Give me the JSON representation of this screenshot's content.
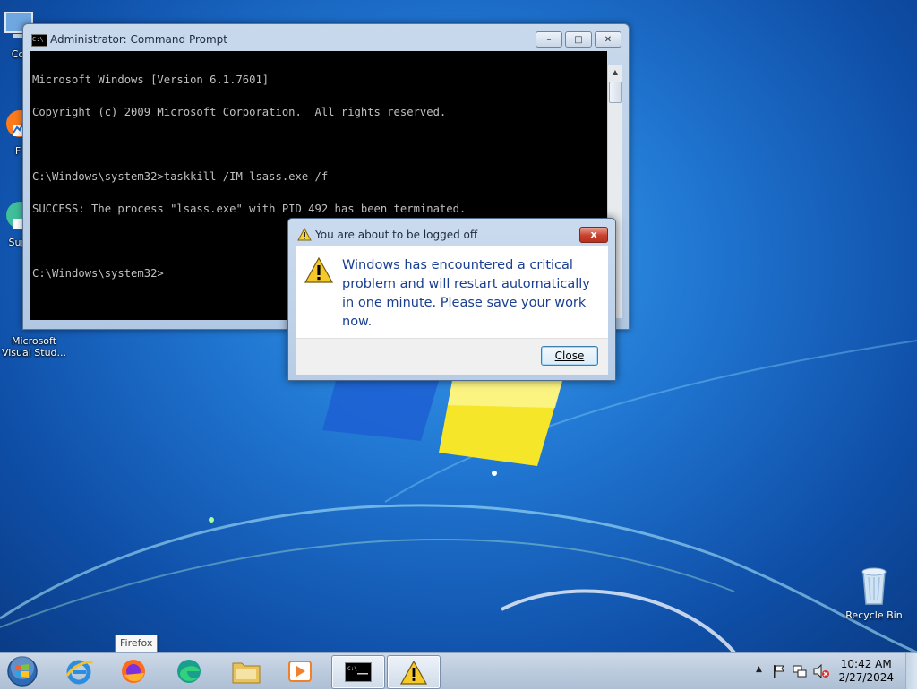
{
  "desktop": {
    "icons": [
      {
        "label": "Co"
      },
      {
        "label": "F"
      },
      {
        "label": "Sup"
      },
      {
        "label": "Microsoft Visual Stud..."
      }
    ],
    "recycle_bin": "Recycle Bin"
  },
  "cmd_window": {
    "title": "Administrator:  Command Prompt",
    "lines": [
      "Microsoft Windows [Version 6.1.7601]",
      "Copyright (c) 2009 Microsoft Corporation.  All rights reserved.",
      "",
      "C:\\Windows\\system32>taskkill /IM lsass.exe /f",
      "SUCCESS: The process \"lsass.exe\" with PID 492 has been terminated.",
      "",
      "C:\\Windows\\system32>"
    ]
  },
  "dialog": {
    "title": "You are about to be logged off",
    "message": "Windows has encountered a critical problem and will restart automatically in one minute. Please save your work now.",
    "close_label": "Close",
    "x_label": "x"
  },
  "taskbar": {
    "tooltip": "Firefox",
    "pinned": [
      "Internet Explorer",
      "Firefox",
      "Edge",
      "File Explorer",
      "Media Player",
      "Command Prompt",
      "Warning"
    ],
    "clock_time": "10:42 AM",
    "clock_date": "2/27/2024"
  },
  "colors": {
    "desktop_blue": "#1f74cf",
    "dialog_text": "#1a3f91",
    "console_bg": "#000000",
    "console_fg": "#c0c0c0"
  }
}
